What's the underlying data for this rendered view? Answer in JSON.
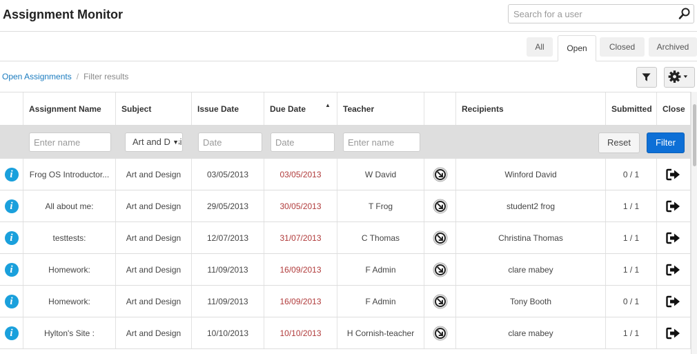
{
  "header": {
    "title": "Assignment Monitor",
    "search_placeholder": "Search for a user"
  },
  "tabs": [
    {
      "label": "All",
      "active": false
    },
    {
      "label": "Open",
      "active": true
    },
    {
      "label": "Closed",
      "active": false
    },
    {
      "label": "Archived",
      "active": false
    }
  ],
  "breadcrumb": {
    "link": "Open Assignments",
    "separator": "/",
    "current": "Filter results"
  },
  "toolbar": {
    "filter_icon": "funnel-icon",
    "settings_icon": "gear-icon"
  },
  "columns": {
    "name": "Assignment Name",
    "subject": "Subject",
    "issue": "Issue Date",
    "due": "Due Date",
    "teacher": "Teacher",
    "recipients": "Recipients",
    "submitted": "Submitted",
    "close": "Close"
  },
  "filters": {
    "name_placeholder": "Enter name",
    "subject_selected": "Art and Design",
    "issue_placeholder": "Date",
    "due_placeholder": "Date",
    "teacher_placeholder": "Enter name",
    "reset_label": "Reset",
    "filter_label": "Filter"
  },
  "colors": {
    "accent": "#0d6fd6",
    "info": "#1aa0dc",
    "due_date": "#b03a3a"
  },
  "rows": [
    {
      "name": "Frog OS Introductor...",
      "subject": "Art and Design",
      "issue": "03/05/2013",
      "due": "03/05/2013",
      "teacher": "W David",
      "recipients": "Winford David",
      "submitted": "0 / 1"
    },
    {
      "name": "All about me:",
      "subject": "Art and Design",
      "issue": "29/05/2013",
      "due": "30/05/2013",
      "teacher": "T Frog",
      "recipients": "student2 frog",
      "submitted": "1 / 1"
    },
    {
      "name": "testtests:",
      "subject": "Art and Design",
      "issue": "12/07/2013",
      "due": "31/07/2013",
      "teacher": "C Thomas",
      "recipients": "Christina Thomas",
      "submitted": "1 / 1"
    },
    {
      "name": "Homework:",
      "subject": "Art and Design",
      "issue": "11/09/2013",
      "due": "16/09/2013",
      "teacher": "F Admin",
      "recipients": "clare mabey",
      "submitted": "1 / 1"
    },
    {
      "name": "Homework:",
      "subject": "Art and Design",
      "issue": "11/09/2013",
      "due": "16/09/2013",
      "teacher": "F Admin",
      "recipients": "Tony Booth",
      "submitted": "0 / 1"
    },
    {
      "name": "Hylton's Site :",
      "subject": "Art and Design",
      "issue": "10/10/2013",
      "due": "10/10/2013",
      "teacher": "H Cornish-teacher",
      "recipients": "clare mabey",
      "submitted": "1 / 1"
    }
  ]
}
